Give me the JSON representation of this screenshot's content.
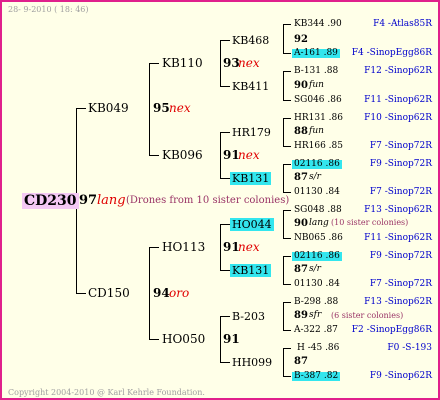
{
  "header": "28-  9-2010 ( 18: 46)",
  "footer": "Copyright 2004-2010 @ Karl Kehrle Foundation.",
  "colors": {
    "frame": "#e0208c",
    "background": "#ffffe8",
    "highlight": "#33e6ee",
    "root_highlight": "#f4c8f4",
    "red": "#e00000",
    "blue": "#0000cc",
    "note": "#993366"
  },
  "root": {
    "id": "CD230",
    "year": "97",
    "race": "lang",
    "note": "(Drones from 10 sister colonies)"
  },
  "gen1": [
    {
      "id": "KB049",
      "year": "95",
      "race": "nex"
    },
    {
      "id": "CD150",
      "year": "94",
      "race": "oro"
    }
  ],
  "gen2": [
    {
      "id": "KB110",
      "year": "93",
      "race": "nex"
    },
    {
      "id": "KB096",
      "year": "91",
      "race": "nex"
    },
    {
      "id": "HO113",
      "year": "91",
      "race": "nex"
    },
    {
      "id": "HO050",
      "year": "91",
      "race": ""
    }
  ],
  "gen3": [
    {
      "id": "KB468",
      "year": "92",
      "race": "",
      "note": ""
    },
    {
      "id": "KB411",
      "year": "90",
      "race": "fun",
      "note": ""
    },
    {
      "id": "HR179",
      "year": "88",
      "race": "fun",
      "note": ""
    },
    {
      "id": "KB131",
      "year": "87",
      "race": "s/r",
      "note": ""
    },
    {
      "id": "HO044",
      "year": "90",
      "race": "lang",
      "note": "(10 sister colonies)"
    },
    {
      "id": "KB131",
      "year": "87",
      "race": "s/r",
      "note": ""
    },
    {
      "id": "B-203",
      "year": "89",
      "race": "sfr",
      "note": "(6 sister colonies)"
    },
    {
      "id": "HH099",
      "year": "87",
      "race": "",
      "note": ""
    }
  ],
  "gen4": [
    {
      "id": "KB344 .90",
      "ped": "F4 -Atlas85R"
    },
    {
      "id": "A-161 .89",
      "ped": "F4 -SinopEgg86R"
    },
    {
      "id": "B-131 .88",
      "ped": "F12 -Sinop62R"
    },
    {
      "id": "SG046 .86",
      "ped": "F11 -Sinop62R"
    },
    {
      "id": "HR131 .86",
      "ped": "F10 -Sinop62R"
    },
    {
      "id": "HR166 .85",
      "ped": "F7 -Sinop72R"
    },
    {
      "id": "02116 .86",
      "ped": "F9 -Sinop72R"
    },
    {
      "id": "01130 .84",
      "ped": "F7 -Sinop72R"
    },
    {
      "id": "SG048 .88",
      "ped": "F13 -Sinop62R"
    },
    {
      "id": "NB065 .86",
      "ped": "F11 -Sinop62R"
    },
    {
      "id": "02116 .86",
      "ped": "F9 -Sinop72R"
    },
    {
      "id": "01130 .84",
      "ped": "F7 -Sinop72R"
    },
    {
      "id": "B-298 .88",
      "ped": "F13 -Sinop62R"
    },
    {
      "id": "A-322 .87",
      "ped": "F2 -SinopEgg86R"
    },
    {
      "id": "H -45 .86",
      "ped": "F0 -S-193"
    },
    {
      "id": "B-387 .82",
      "ped": "F9 -Sinop62R"
    }
  ]
}
